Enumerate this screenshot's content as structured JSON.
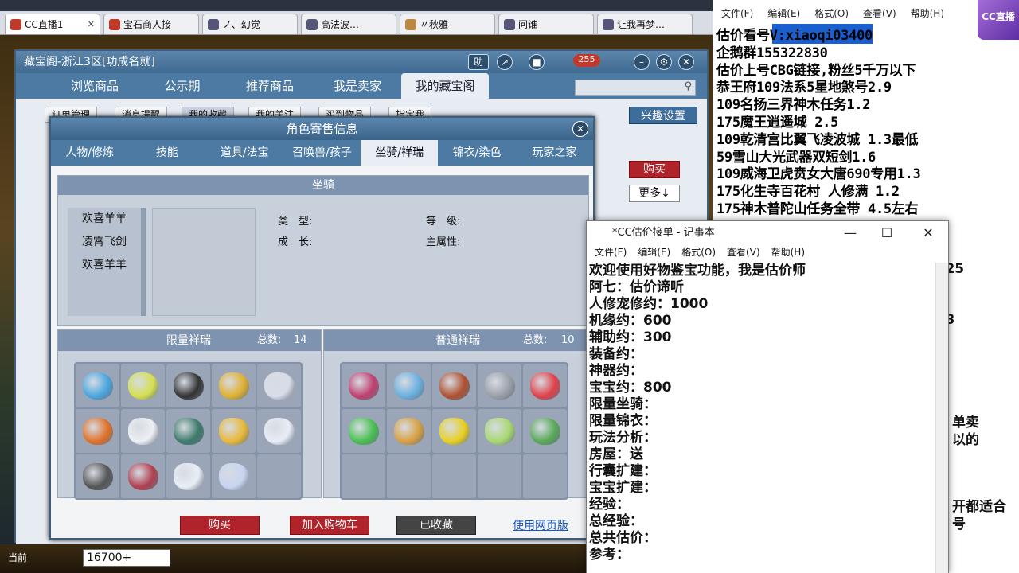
{
  "browser_tabs": [
    {
      "label": "CC直播1",
      "active": true
    },
    {
      "label": "宝石商人接"
    },
    {
      "label": "ノ、幻觉"
    },
    {
      "label": "高法波…"
    },
    {
      "label": "〃秋雅"
    },
    {
      "label": "问谁"
    },
    {
      "label": "让我再梦…"
    }
  ],
  "cbg": {
    "title": "藏宝阁-浙江3区[功成名就]",
    "nav": [
      "浏览商品",
      "公示期",
      "推荐商品",
      "我是卖家",
      "我的藏宝阁"
    ],
    "badge": "255",
    "subtabs": [
      "订单管理",
      "消息提醒",
      "我的收藏",
      "我的关注",
      "买到物品",
      "指定我"
    ],
    "interest_btn": "兴趣设置",
    "buy_btn": "购买",
    "more_btn": "更多↓"
  },
  "dialog": {
    "title": "角色寄售信息",
    "tabs": [
      "人物/修炼",
      "技能",
      "道具/法宝",
      "召唤兽/孩子",
      "坐骑/祥瑞",
      "锦衣/染色",
      "玩家之家"
    ],
    "mount_header": "坐骑",
    "mounts": [
      "欢喜羊羊",
      "凌霄飞剑",
      "欢喜羊羊"
    ],
    "fields": {
      "type": "类　型:",
      "level": "等　级:",
      "growth": "成　长:",
      "attr": "主属性:"
    },
    "limited": {
      "title": "限量祥瑞",
      "total_label": "总数:",
      "total": "14"
    },
    "normal": {
      "title": "普通祥瑞",
      "total_label": "总数:",
      "total": "10"
    },
    "buttons": {
      "buy": "购买",
      "add_cart": "加入购物车",
      "collected": "已收藏",
      "web": "使用网页版"
    }
  },
  "limited_pets": [
    "#4aa6e0",
    "#d6e050",
    "#333333",
    "#e0b030",
    "#d8dce8",
    "#e07028",
    "#eceff4",
    "#3c7a6a",
    "#e8b838",
    "#e8ecf6",
    "#555555",
    "#b04050",
    "#e8eef6",
    "#c8d4f0"
  ],
  "normal_pets": [
    "#c04070",
    "#6ab0e0",
    "#b05030",
    "#9aa0a8",
    "#e04048",
    "#48c050",
    "#d8a040",
    "#e8d020",
    "#a8d870",
    "#58a858"
  ],
  "gold": "16700+",
  "bottom_label": "当前",
  "notepad_bg": {
    "menu": [
      "文件(F)",
      "编辑(E)",
      "格式(O)",
      "查看(V)",
      "帮助(H)"
    ],
    "lines": [
      "估价看号V:xiaoqi03400",
      "企鹅群155322830",
      "估价上号CBG链接,粉丝5千万以下",
      "恭王府109法系5星地煞号2.9",
      "109名扬三界神木任务1.2",
      "175魔王逍遥城 2.5",
      "109乾清宫比翼飞凌波城 1.3最低",
      "59雪山大光武器双短剑1.6",
      "109威海卫虎贲女大唐690专用1.3",
      "175化生寺百花村 人修满 1.2",
      "175神木普陀山任务全带 4.5左右"
    ],
    "right_fragments": [
      ".25",
      ".3",
      "单卖",
      "以的",
      "开都适合",
      "号"
    ],
    "logo": "CC直播"
  },
  "notepad": {
    "title": "*CC估价接单 - 记事本",
    "menu": [
      "文件(F)",
      "编辑(E)",
      "格式(O)",
      "查看(V)",
      "帮助(H)"
    ],
    "lines": [
      "欢迎使用好物鉴宝功能，我是估价师",
      "阿七：估价谛听",
      "人修宠修约：1000",
      "机缘约：600",
      "辅助约：300",
      "装备约：",
      "神器约：",
      "宝宝约：800",
      "限量坐骑：",
      "限量锦衣：",
      "玩法分析：",
      "房屋：送",
      "行囊扩建：",
      "宝宝扩建：",
      "经验：",
      "总经验：",
      "总共估价：",
      "参考："
    ]
  }
}
